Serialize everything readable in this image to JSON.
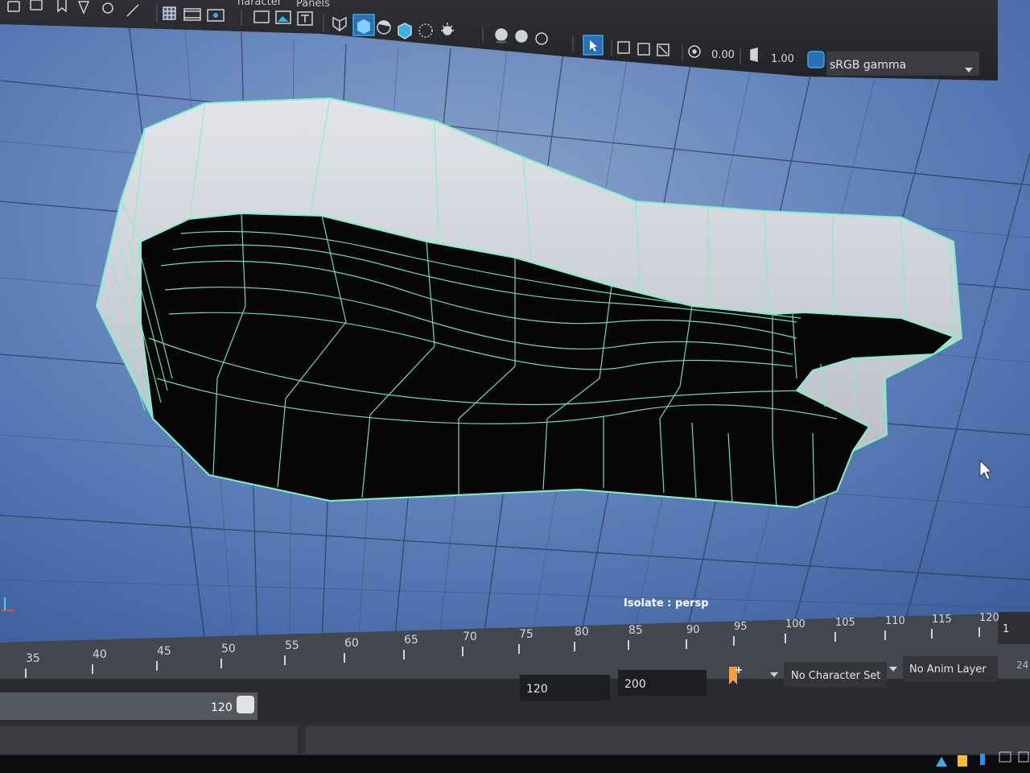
{
  "menu": {
    "left_partial": "haracter",
    "panels": "Panels"
  },
  "toolbar": {
    "exposure": "0.00",
    "gamma": "1.00",
    "colorspace": "sRGB gamma",
    "icons": [
      "grid-icon",
      "film-gate-icon",
      "resolution-gate-icon",
      "safe-action-icon",
      "image-plane-icon",
      "field-chart-icon",
      "wireframe-icon",
      "smooth-shade-icon",
      "shaded-wireframe-icon",
      "xray-icon",
      "textured-icon",
      "lights-icon",
      "shadows-icon",
      "ambient-occlusion-icon",
      "motion-blur-icon",
      "isolate-select-icon",
      "camera-attr-icon",
      "bookmark-icon",
      "exposure-icon",
      "gamma-icon",
      "color-management-icon"
    ]
  },
  "viewport": {
    "label": "Isolate : persp"
  },
  "timeline": {
    "ticks_upper": [
      "90",
      "95",
      "100",
      "105",
      "110",
      "115",
      "120"
    ],
    "ticks_lower": [
      "35",
      "40",
      "45",
      "50",
      "55",
      "60",
      "65",
      "70",
      "75",
      "80",
      "85"
    ],
    "current_frame": "1"
  },
  "range": {
    "playback_end": "120",
    "animation_end": "200",
    "slider_end": "120",
    "character_set": "No Character Set",
    "anim_layer": "No Anim Layer",
    "fps_partial": "24"
  }
}
